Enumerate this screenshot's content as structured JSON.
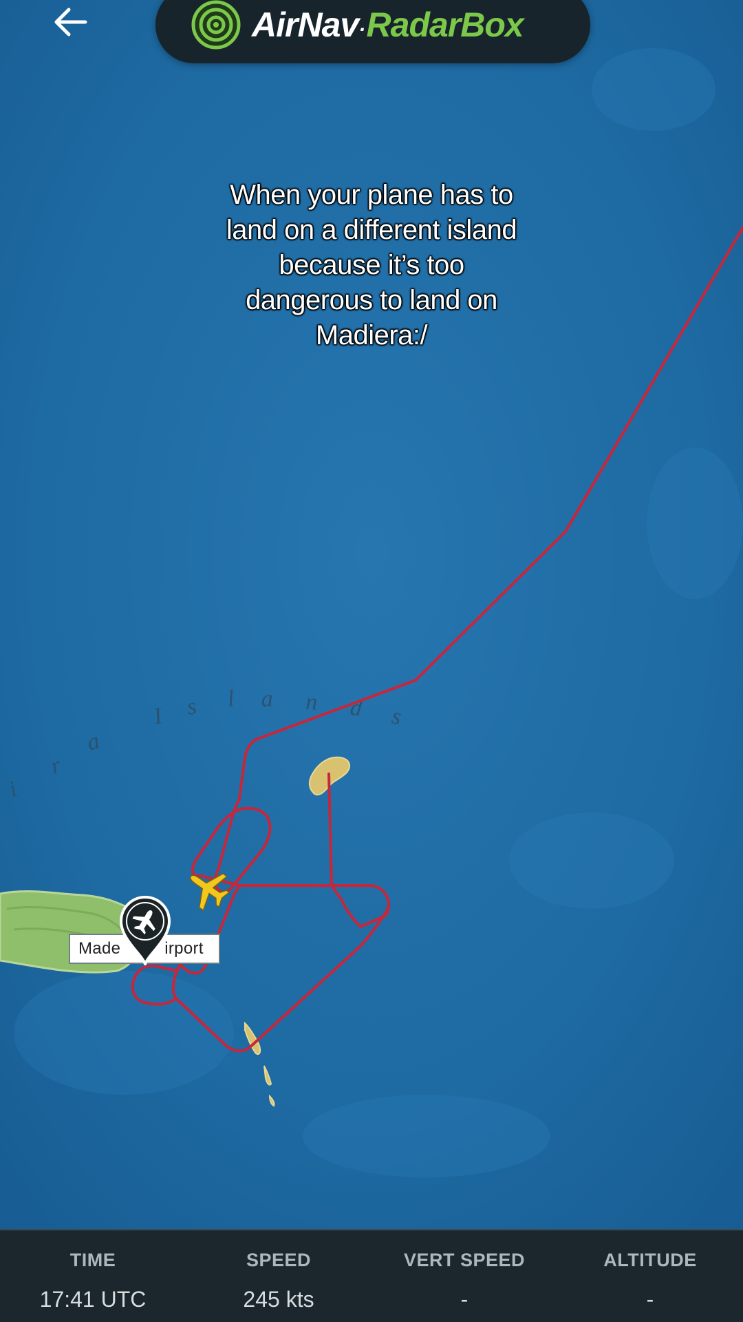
{
  "header": {
    "back_icon": "arrow-left-icon",
    "brand": {
      "logo_icon": "radar-logo-icon",
      "name_part1": "AirNav",
      "name_separator": ".",
      "name_part2": "RadarBox",
      "colors": {
        "primary_text": "#ffffff",
        "accent": "#7cc84a",
        "pill_bg": "#17242b"
      }
    }
  },
  "caption": {
    "line1": "When your plane has to",
    "line2": "land on a different island",
    "line3": "because it’s too",
    "line4": "dangerous to land on",
    "line5": "Madiera:/"
  },
  "map": {
    "region_label_chars": [
      "i",
      "r",
      "a",
      "I",
      "s",
      "l",
      "a",
      "n",
      "d",
      "s"
    ],
    "airport_label": "Madeira Airport",
    "airport_label_visible_left": "Made",
    "airport_label_visible_right": "irport",
    "airport_icon": "airport-pin-icon",
    "aircraft_icon": "airplane-icon",
    "colors": {
      "sea": "#1f6aa3",
      "flight_path": "#c8263a",
      "aircraft": "#f2c81e",
      "land": "#8fbf6a"
    }
  },
  "stats": {
    "time": {
      "label": "TIME",
      "value": "17:41 UTC"
    },
    "speed": {
      "label": "SPEED",
      "value": "245 kts"
    },
    "vert_speed": {
      "label": "VERT SPEED",
      "value": "-"
    },
    "altitude": {
      "label": "ALTITUDE",
      "value": "-"
    }
  }
}
